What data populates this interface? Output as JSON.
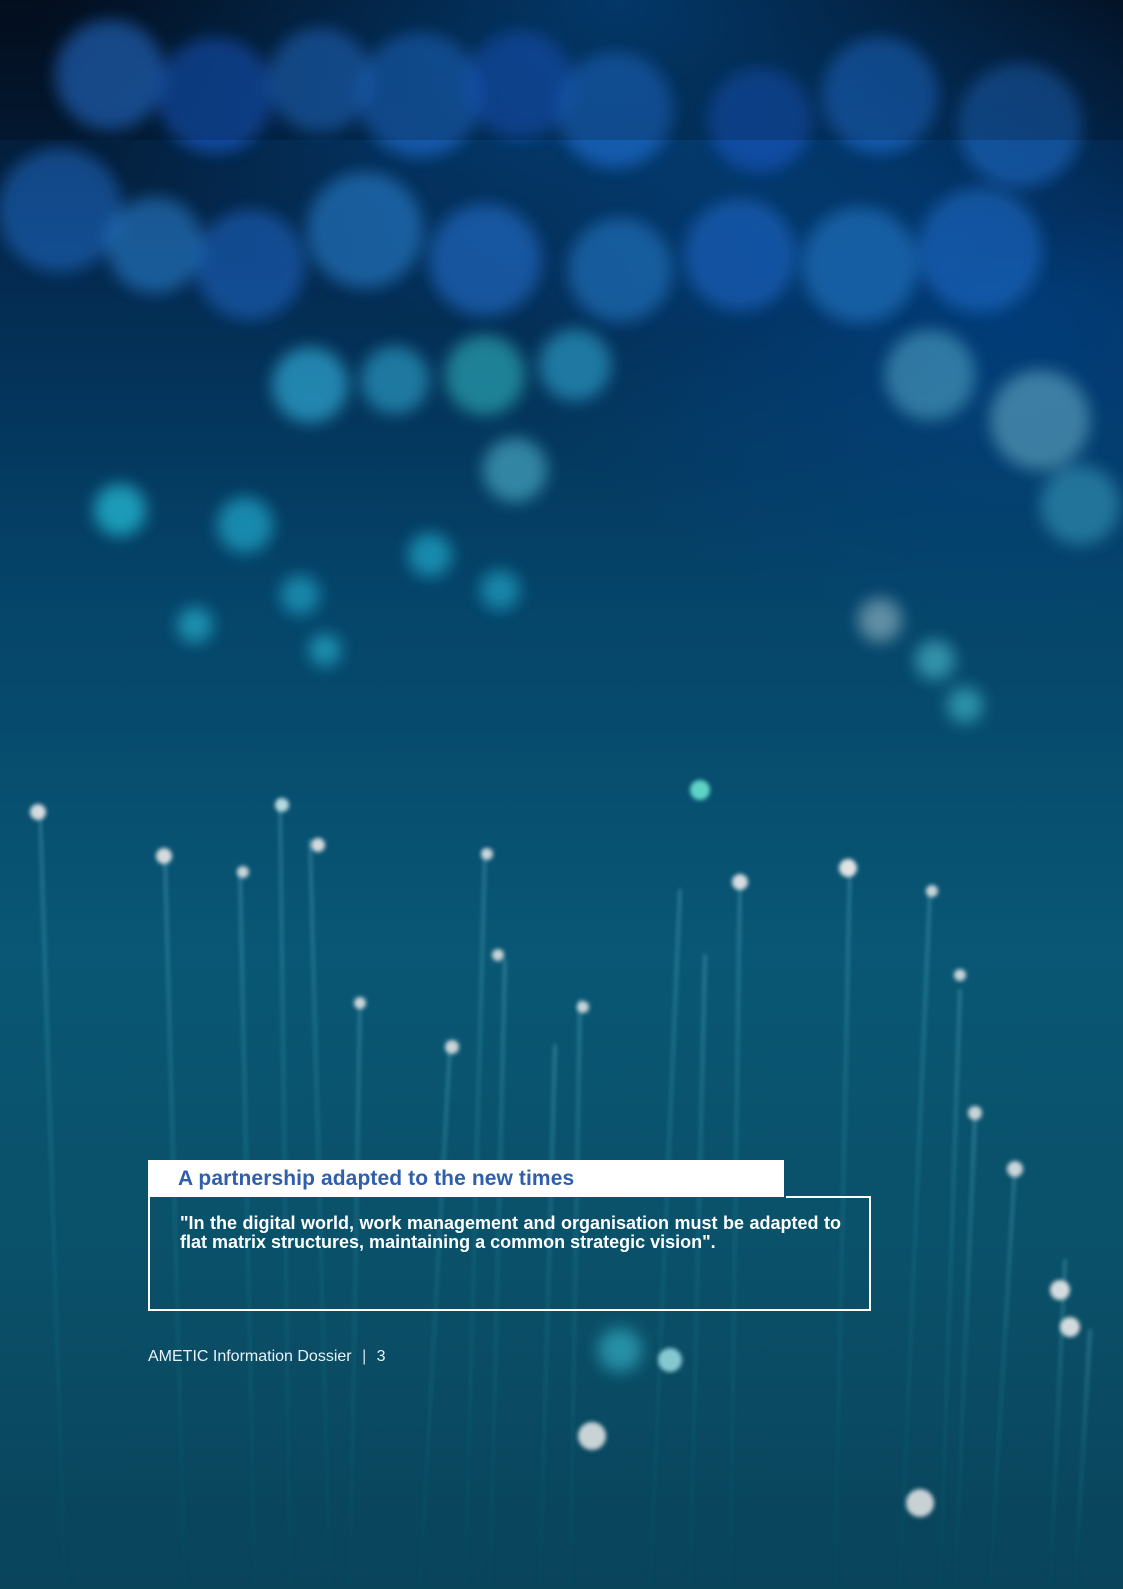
{
  "page": {
    "headline": "A partnership adapted to the new times",
    "quote": "\"In the digital world, work management and organisation must be adapted to flat matrix structures, maintaining a common strategic vision\".",
    "footer_label": "AMETIC Information Dossier",
    "footer_separator": "|",
    "page_number": "3"
  },
  "colors": {
    "accent": "#2e5fae",
    "text_light": "#ffffff",
    "background_dark": "#041227",
    "background_teal": "#0a5f7e"
  }
}
